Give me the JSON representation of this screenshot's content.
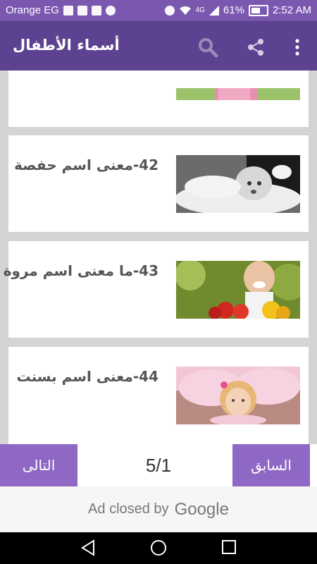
{
  "status_bar": {
    "carrier": "Orange EG",
    "network": "4G",
    "battery": "61%",
    "time": "2:52 AM"
  },
  "app_bar": {
    "title": "أسماء الأطفال"
  },
  "cards": [
    {
      "title": "",
      "image": "girl-pink-dress-partial"
    },
    {
      "title": "42-معنى اسم حفصة",
      "image": "baby-lying-white"
    },
    {
      "title": "43-ما معنى اسم مروة",
      "image": "girl-smiling-apples"
    },
    {
      "title": "44-معنى اسم بسنت",
      "image": "girl-pink-tutu"
    }
  ],
  "pagination": {
    "next_label": "التالى",
    "prev_label": "السابق",
    "page_indicator": "5/1"
  },
  "ad": {
    "text": "Ad closed by",
    "brand": "Google"
  },
  "colors": {
    "status_bar": "#7a58b0",
    "app_bar": "#5c4290",
    "nav_button": "#8e68c4",
    "background": "#d4d4d4"
  }
}
